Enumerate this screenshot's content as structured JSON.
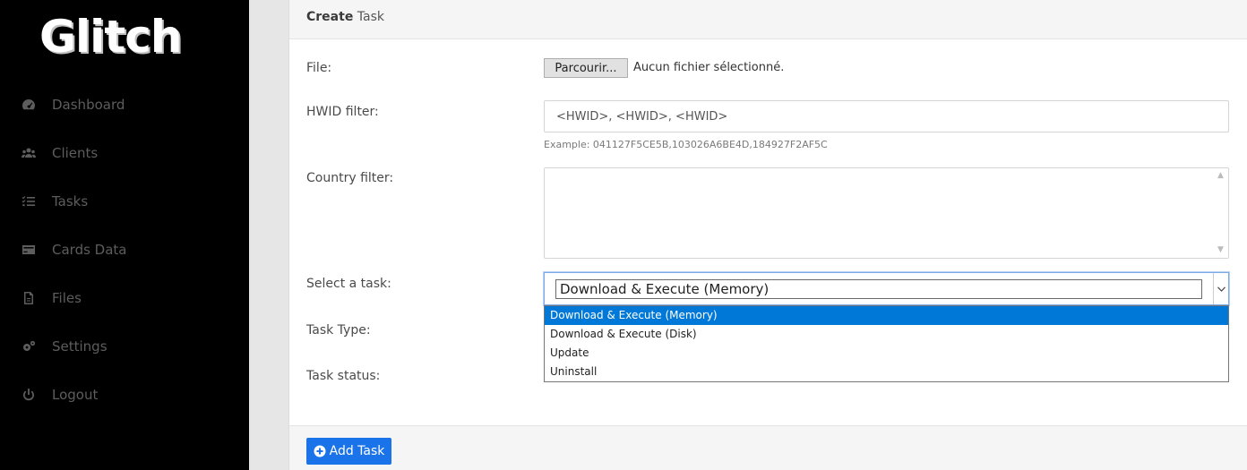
{
  "brand": {
    "logo_text": "Glitch"
  },
  "sidebar": {
    "items": [
      {
        "label": "Dashboard",
        "icon": "dashboard-icon"
      },
      {
        "label": "Clients",
        "icon": "users-icon"
      },
      {
        "label": "Tasks",
        "icon": "tasks-icon"
      },
      {
        "label": "Cards Data",
        "icon": "credit-card-icon"
      },
      {
        "label": "Files",
        "icon": "file-icon"
      },
      {
        "label": "Settings",
        "icon": "gears-icon"
      },
      {
        "label": "Logout",
        "icon": "power-icon"
      }
    ]
  },
  "card": {
    "title_bold": "Create",
    "title_rest": " Task"
  },
  "form": {
    "file_label": "File:",
    "file_button": "Parcourir...",
    "file_status": "Aucun fichier sélectionné.",
    "hwid_label": "HWID filter:",
    "hwid_placeholder": "<HWID>, <HWID>, <HWID>",
    "hwid_help": "Example: 041127F5CE5B,103026A6BE4D,184927F2AF5C",
    "country_label": "Country filter:",
    "task_label": "Select a task:",
    "task_selected": "Download & Execute (Memory)",
    "task_options": [
      "Download & Execute (Memory)",
      "Download & Execute (Disk)",
      "Update",
      "Uninstall"
    ],
    "task_type_label": "Task Type:",
    "task_status_label": "Task status:",
    "add_button": "Add Task"
  },
  "colors": {
    "accent": "#1a73e8",
    "selected_option": "#0078d7",
    "sidebar_bg": "#000000"
  }
}
